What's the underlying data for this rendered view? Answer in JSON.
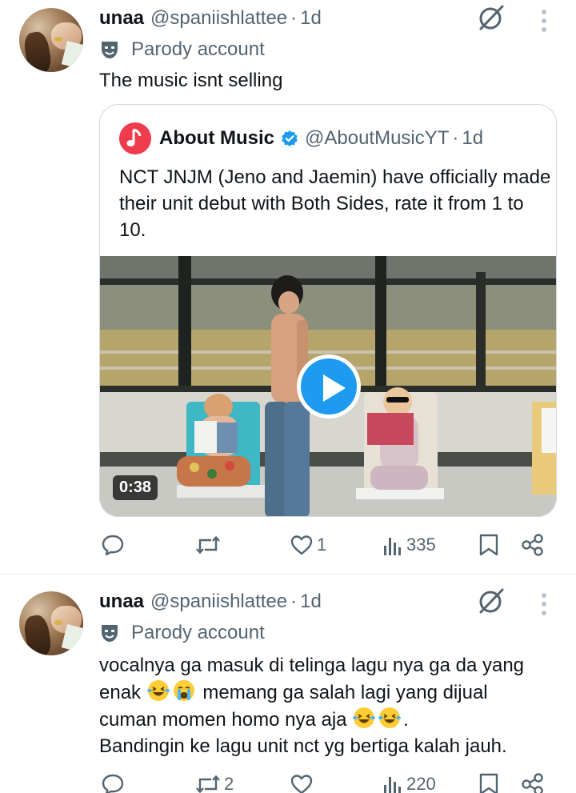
{
  "tweets": [
    {
      "author": {
        "name": "unaa",
        "handle": "@spaniishlattee",
        "time": "1d",
        "dot": "·"
      },
      "label": "Parody account",
      "text": "The music isnt selling",
      "quote": {
        "author": {
          "name": "About Music",
          "handle": "@AboutMusicYT",
          "time": "1d",
          "dot": "·"
        },
        "text": "NCT JNJM (Jeno and Jaemin) have officially made their unit debut with Both Sides, rate it from 1 to 10.",
        "video": {
          "duration": "0:38"
        }
      },
      "stats": {
        "replies": "",
        "reposts": "",
        "likes": "1",
        "views": "335"
      }
    },
    {
      "author": {
        "name": "unaa",
        "handle": "@spaniishlattee",
        "time": "1d",
        "dot": "·"
      },
      "label": "Parody account",
      "text": {
        "l1": "vocalnya ga masuk di telinga lagu nya ga da yang",
        "l2a": "enak",
        "l2b": " memang ga salah lagi yang dijual",
        "l3a": "cuman momen homo nya aja",
        "l3b": ".",
        "l4": "Bandingin ke lagu unit nct yg bertiga kalah jauh."
      },
      "stats": {
        "replies": "",
        "reposts": "2",
        "likes": "",
        "views": "220"
      }
    }
  ],
  "colors": {
    "accent": "#1d9bf0",
    "secondary_text": "#536471",
    "border": "#cfd9de",
    "brand_red": "#ef3c4d"
  },
  "icons": [
    "grok-icon",
    "more-icon",
    "parody-mask-icon",
    "verified-icon",
    "play-icon",
    "reply-icon",
    "repost-icon",
    "like-icon",
    "views-icon",
    "bookmark-icon",
    "share-icon",
    "laughing-emoji",
    "crying-emoji"
  ]
}
